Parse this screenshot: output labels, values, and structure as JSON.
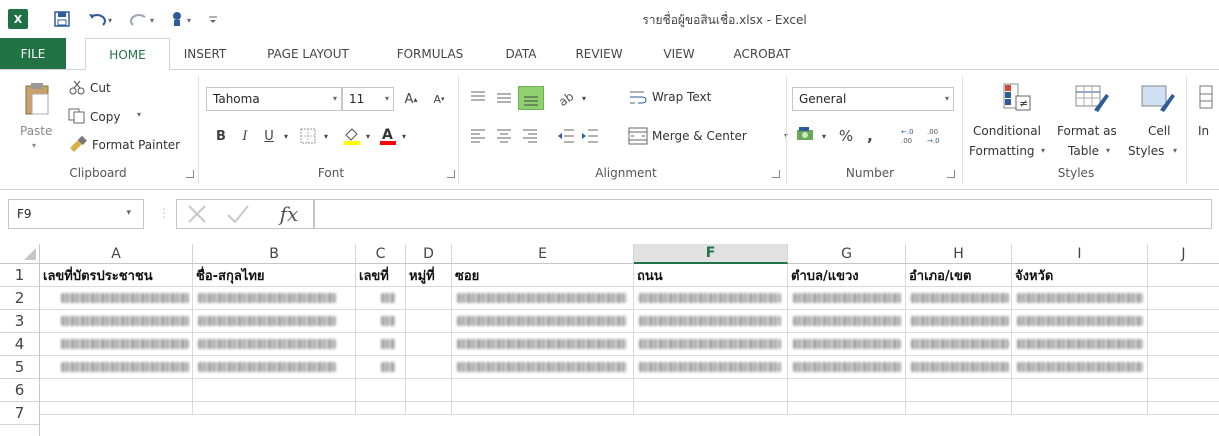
{
  "title_bar": {
    "filename": "รายชื่อผู้ขอสินเชื่อ.xlsx - Excel"
  },
  "tabs": [
    {
      "label": "FILE"
    },
    {
      "label": "HOME"
    },
    {
      "label": "INSERT"
    },
    {
      "label": "PAGE LAYOUT"
    },
    {
      "label": "FORMULAS"
    },
    {
      "label": "DATA"
    },
    {
      "label": "REVIEW"
    },
    {
      "label": "VIEW"
    },
    {
      "label": "ACROBAT"
    }
  ],
  "ribbon": {
    "clipboard": {
      "paste": "Paste",
      "cut": "Cut",
      "copy": "Copy",
      "format_painter": "Format Painter",
      "label": "Clipboard"
    },
    "font": {
      "name": "Tahoma",
      "size": "11",
      "bold": "B",
      "italic": "I",
      "underline": "U",
      "label": "Font"
    },
    "alignment": {
      "wrap_text": "Wrap Text",
      "merge_center": "Merge & Center",
      "label": "Alignment"
    },
    "number": {
      "format": "General",
      "percent": "%",
      "comma": ",",
      "label": "Number"
    },
    "styles": {
      "conditional_1": "Conditional",
      "conditional_2": "Formatting",
      "format_as_1": "Format as",
      "format_as_2": "Table",
      "cell_1": "Cell",
      "cell_2": "Styles",
      "label": "Styles"
    },
    "insert_partial": "In"
  },
  "formula_bar": {
    "name_box": "F9",
    "fx": "fx",
    "value": ""
  },
  "grid": {
    "columns": [
      "A",
      "B",
      "C",
      "D",
      "E",
      "F",
      "G",
      "H",
      "I",
      "J"
    ],
    "rows": [
      "1",
      "2",
      "3",
      "4",
      "5",
      "6",
      "7"
    ],
    "headers": [
      "เลขที่บัตรประชาชน",
      "ชื่อ-สกุลไทย",
      "เลขที่",
      "หมู่ที่",
      "ซอย",
      "ถนน",
      "ตำบล/แขวง",
      "อำเภอ/เขต",
      "จังหวัด"
    ],
    "selected_column": "F"
  },
  "colors": {
    "excel_green": "#217346",
    "selected_header": "#e1e1e1",
    "highlight_fill": "#90d06e"
  }
}
